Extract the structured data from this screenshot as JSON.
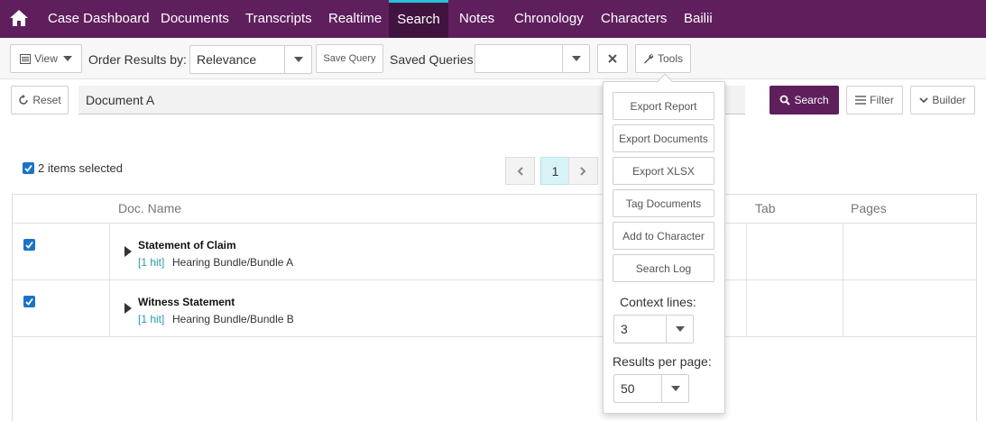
{
  "nav": {
    "home_icon": "home-icon",
    "items": [
      {
        "label": "Case Dashboard"
      },
      {
        "label": "Documents"
      },
      {
        "label": "Transcripts"
      },
      {
        "label": "Realtime"
      },
      {
        "label": "Search"
      },
      {
        "label": "Notes"
      },
      {
        "label": "Chronology"
      },
      {
        "label": "Characters"
      },
      {
        "label": "Bailii"
      }
    ],
    "active": "Search",
    "colors": {
      "bar": "#5e1f5c",
      "active_bg": "#411440",
      "active_accent": "#27c0d6"
    }
  },
  "toolbar": {
    "view_label": "View",
    "order_label": "Order Results by:",
    "order_value": "Relevance",
    "save_query_label": "Save Query",
    "saved_queries_label": "Saved Queries:",
    "saved_queries_value": "",
    "clear_icon": "x-icon",
    "tools_label": "Tools"
  },
  "search": {
    "reset_label": "Reset",
    "query": "Document A",
    "search_label": "Search",
    "filter_label": "Filter",
    "builder_label": "Builder"
  },
  "selection": {
    "text": "2 items selected"
  },
  "pagination": {
    "current": "1"
  },
  "table": {
    "headers": {
      "doc_name": "Doc. Name",
      "tab": "Tab",
      "pages": "Pages"
    },
    "rows": [
      {
        "checked": true,
        "name": "Statement of Claim",
        "hits": "[1 hit]",
        "path": "Hearing Bundle/Bundle A"
      },
      {
        "checked": true,
        "name": "Witness Statement",
        "hits": "[1 hit]",
        "path": "Hearing Bundle/Bundle B"
      }
    ]
  },
  "tools_menu": {
    "items": [
      {
        "label": "Export Report"
      },
      {
        "label": "Export Documents"
      },
      {
        "label": "Export XLSX"
      },
      {
        "label": "Tag Documents"
      },
      {
        "label": "Add to Character"
      },
      {
        "label": "Search Log"
      }
    ],
    "context_lines_label": "Context lines:",
    "context_lines_value": "3",
    "results_per_page_label": "Results per page:",
    "results_per_page_value": "50"
  }
}
